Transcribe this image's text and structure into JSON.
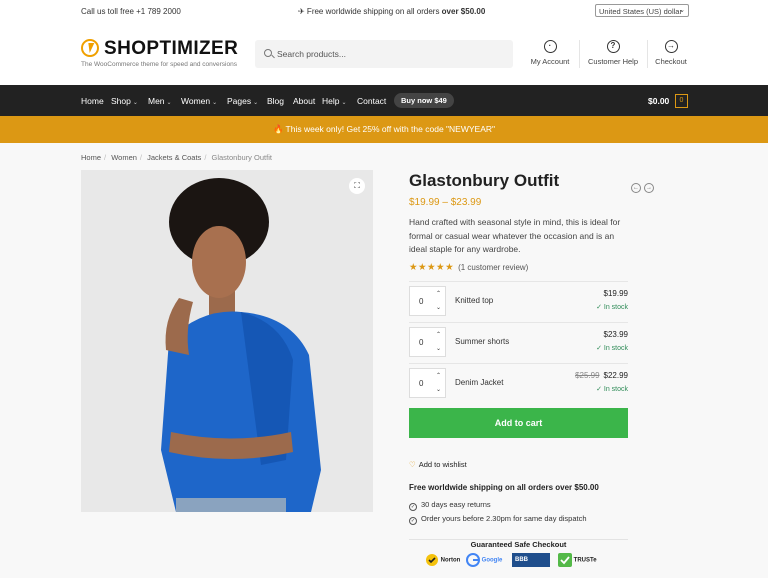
{
  "topbar": {
    "phone": "Call us toll free +1 789 2000",
    "shipping_prefix": "✈ Free worldwide shipping on all orders",
    "shipping_bold": "over $50.00",
    "currency": "United States (US) dollar"
  },
  "header": {
    "logo_text": "SHOPTIMIZER",
    "tagline": "The WooCommerce theme for speed and conversions",
    "search_placeholder": "Search products...",
    "links": [
      "My Account",
      "Customer Help",
      "Checkout"
    ]
  },
  "nav": {
    "items": [
      "Home",
      "Shop",
      "Men",
      "Women",
      "Pages",
      "Blog",
      "About",
      "Help",
      "Contact"
    ],
    "buy_label": "Buy now $49",
    "cart_total": "$0.00",
    "cart_count": "0"
  },
  "promo": {
    "text": "This week only! Get 25% off with the code \"NEWYEAR\""
  },
  "breadcrumb": [
    "Home",
    "Women",
    "Jackets & Coats",
    "Glastonbury Outfit"
  ],
  "product": {
    "title": "Glastonbury Outfit",
    "price": "$19.99 – $23.99",
    "description": "Hand crafted with seasonal style in mind, this is ideal for formal or casual wear whatever the occasion and is an ideal staple for any wardrobe.",
    "stars": "★★★★★",
    "review_text": "(1 customer review)",
    "group": [
      {
        "qty": "0",
        "name": "Knitted top",
        "old_price": "",
        "price": "$19.99",
        "stock": "✓  In stock"
      },
      {
        "qty": "0",
        "name": "Summer shorts",
        "old_price": "",
        "price": "$23.99",
        "stock": "✓  In stock"
      },
      {
        "qty": "0",
        "name": "Denim Jacket",
        "old_price": "$25.99",
        "price": "$22.99",
        "stock": "✓  In stock"
      }
    ],
    "add_to_cart": "Add to cart",
    "wishlist": "Add to wishlist",
    "shipping_title": "Free worldwide shipping on all orders over $50.00",
    "features": [
      "30 days easy returns",
      "Order yours before 2.30pm for same day dispatch"
    ],
    "safe_title": "Guaranteed Safe Checkout",
    "badges": [
      "Norton",
      "Google",
      "BBB",
      "TRUSTe"
    ]
  },
  "colors": {
    "accent": "#dc9814",
    "nav_bg": "#222222",
    "cart_button": "#3bb54a"
  }
}
